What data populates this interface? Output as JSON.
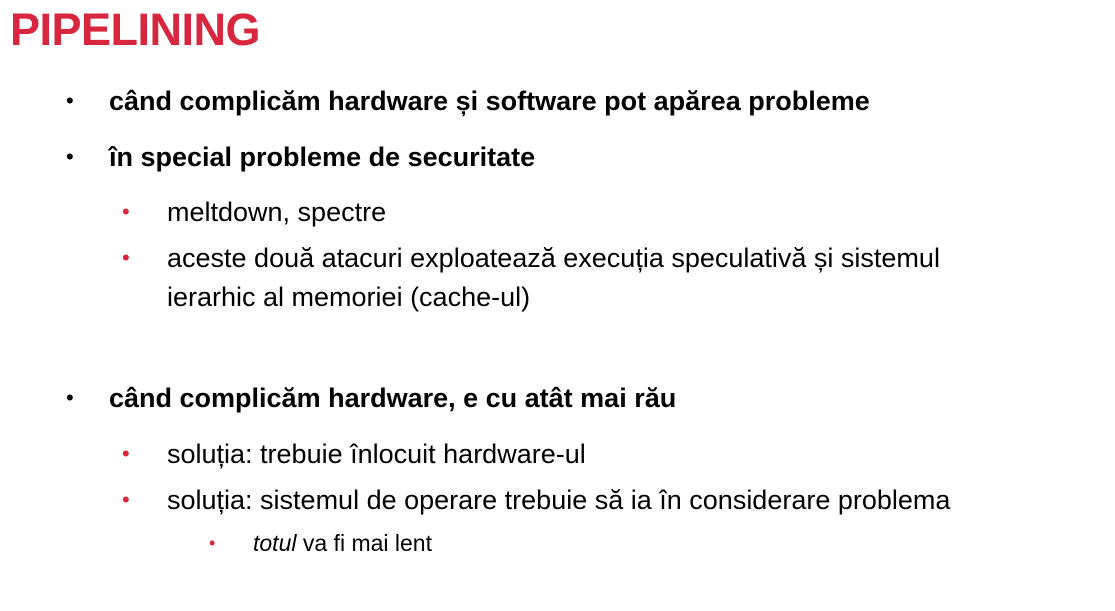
{
  "slide": {
    "title": "PIPELINING",
    "bullet_symbol": "•",
    "items": [
      {
        "level": 1,
        "text": "când complicăm hardware și software pot apărea probleme"
      },
      {
        "level": 1,
        "text": "în special probleme de securitate"
      },
      {
        "level": 2,
        "text": "meltdown, spectre"
      },
      {
        "level": 2,
        "line1": "aceste două atacuri exploatează execuția speculativă și sistemul",
        "line2": "ierarhic al memoriei (cache-ul)"
      },
      {
        "level": 1,
        "text": "când complicăm hardware, e cu atât mai rău"
      },
      {
        "level": 2,
        "text": "soluția: trebuie înlocuit hardware-ul"
      },
      {
        "level": 2,
        "text": "soluția: sistemul de operare trebuie să ia în considerare problema"
      },
      {
        "level": 3,
        "italic": "totul",
        "rest": " va fi mai lent"
      }
    ],
    "colors": {
      "title": "#d7263d",
      "sub_bullet": "#d7263d",
      "text": "#000000"
    }
  }
}
